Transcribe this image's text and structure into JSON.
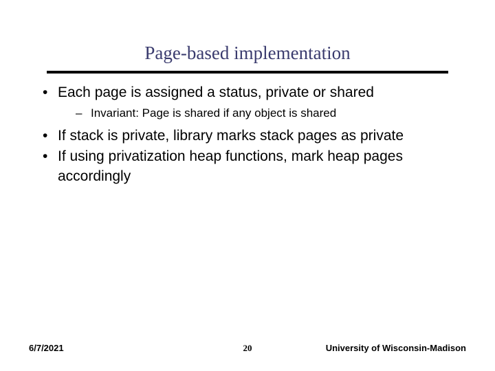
{
  "title": "Page-based implementation",
  "bullets": [
    {
      "text": "Each page is assigned a status, private or shared",
      "sub": [
        {
          "text": "Invariant: Page is shared if any object is shared"
        }
      ]
    },
    {
      "text": "If stack is private, library marks stack pages as private"
    },
    {
      "text": "If using privatization heap functions, mark heap pages accordingly"
    }
  ],
  "footer": {
    "date": "6/7/2021",
    "page": "20",
    "affiliation": "University of Wisconsin-Madison"
  }
}
